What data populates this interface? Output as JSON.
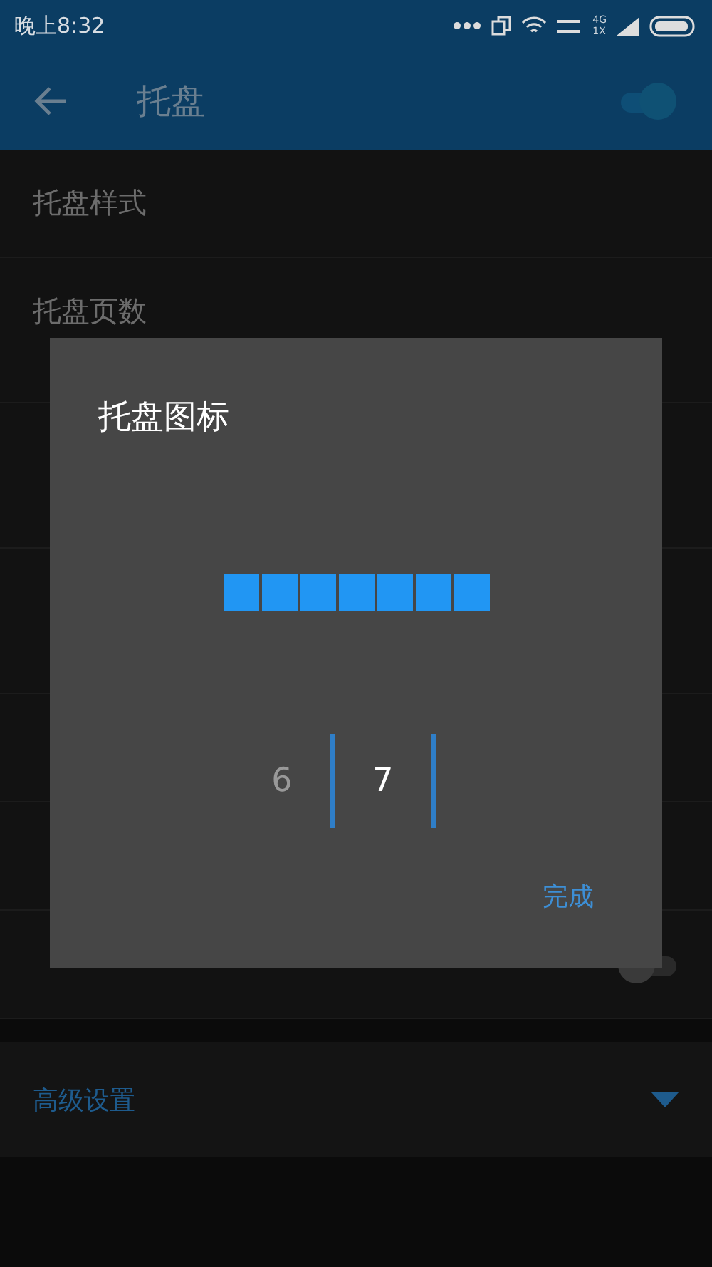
{
  "status_bar": {
    "time": "晚上8:32",
    "network_top": "4G",
    "network_bottom": "1X"
  },
  "app_bar": {
    "title": "托盘",
    "switch_on": true
  },
  "settings": [
    {
      "title": "托盘样式",
      "kind": "single"
    },
    {
      "title": "托盘页数",
      "kind": "double"
    },
    {
      "kind": "double"
    },
    {
      "kind": "double"
    },
    {
      "kind": "single"
    },
    {
      "kind": "single"
    },
    {
      "kind": "switch",
      "on": false
    }
  ],
  "section": {
    "title": "高级设置",
    "expanded": false
  },
  "dialog": {
    "title": "托盘图标",
    "preview_cells": [
      {
        "filled": true
      },
      {
        "filled": true
      },
      {
        "filled": true
      },
      {
        "filled": true
      },
      {
        "filled": true
      },
      {
        "filled": true
      },
      {
        "filled": true
      }
    ],
    "picker": [
      {
        "label": "6",
        "selected": false
      },
      {
        "label": "7",
        "selected": true
      }
    ],
    "button": "完成"
  }
}
